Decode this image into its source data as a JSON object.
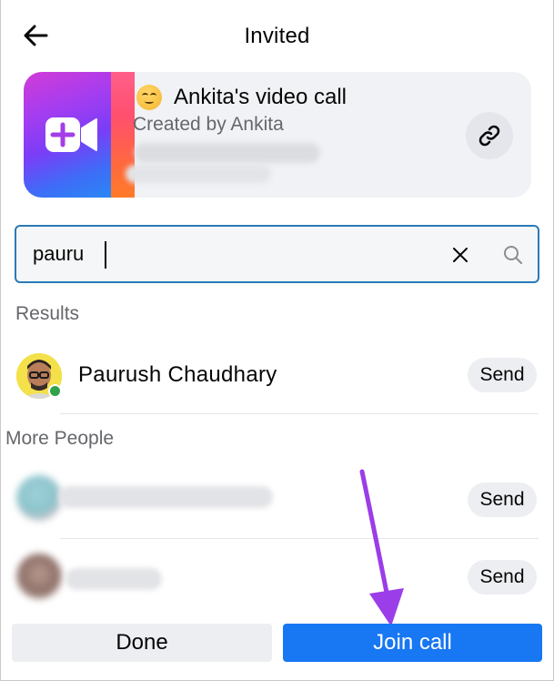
{
  "header": {
    "title": "Invited",
    "back_icon": "arrow-left-icon"
  },
  "call": {
    "title": "Ankita's video call",
    "created_by": "Created by Ankita",
    "emoji_icon": "smiling-face-icon",
    "thumb_icon": "video-plus-icon",
    "link_icon": "link-icon"
  },
  "search": {
    "value": "pauru",
    "clear_icon": "close-icon",
    "search_icon": "search-icon"
  },
  "results": {
    "label": "Results",
    "people": [
      {
        "name": "Paurush Chaudhary",
        "action": "Send",
        "status": "online"
      }
    ]
  },
  "more_people": {
    "label": "More People",
    "people": [
      {
        "action": "Send"
      },
      {
        "action": "Send"
      }
    ]
  },
  "footer": {
    "done_label": "Done",
    "join_label": "Join call"
  },
  "colors": {
    "accent": "#1877f2",
    "online": "#31a24c",
    "annotation_arrow": "#9b3de8",
    "search_border": "#2a7ab6"
  }
}
